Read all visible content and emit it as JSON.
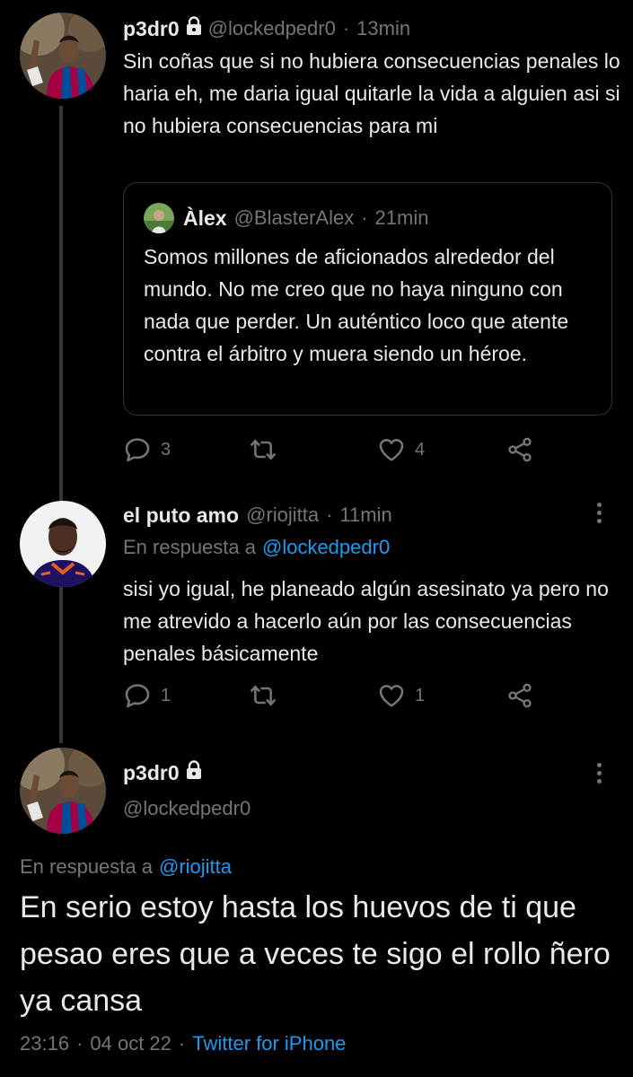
{
  "tweet1": {
    "display_name": "p3dr0",
    "handle": "@lockedpedr0",
    "time": "13min",
    "text": "Sin coñas que si no hubiera consecuencias penales lo haria eh, me daria igual quitarle la vida a alguien asi si no hubiera consecuencias para mi",
    "quote": {
      "display_name": "Àlex",
      "handle": "@BlasterAlex",
      "time": "21min",
      "text": "Somos millones de aficionados alrededor del mundo. No me creo que no haya ninguno con nada que perder. Un auténtico loco que atente contra el árbitro y muera siendo un héroe."
    },
    "replies": "3",
    "likes": "4"
  },
  "tweet2": {
    "display_name": "el puto amo",
    "handle": "@riojitta",
    "time": "11min",
    "reply_prefix": "En respuesta a",
    "reply_to": "@lockedpedr0",
    "text": "sisi yo igual, he planeado algún asesinato ya pero no me atrevido a hacerlo aún por las consecuencias penales básicamente",
    "replies": "1",
    "likes": "1"
  },
  "main": {
    "display_name": "p3dr0",
    "handle": "@lockedpedr0",
    "reply_prefix": "En respuesta a",
    "reply_to": "@riojitta",
    "text": "En serio estoy hasta los huevos de ti que pesao eres que a veces te sigo el rollo ñero ya cansa",
    "time": "23:16",
    "date": "04 oct 22",
    "source": "Twitter for iPhone"
  },
  "separator": "·",
  "icons": {
    "lock": "lock-icon",
    "reply": "reply-icon",
    "retweet": "retweet-icon",
    "like": "heart-icon",
    "share": "share-icon",
    "more": "more-icon"
  },
  "colors": {
    "background": "#000000",
    "text": "#e7e9ea",
    "secondary": "#71767b",
    "link": "#1d9bf0",
    "border": "#2f3336"
  }
}
